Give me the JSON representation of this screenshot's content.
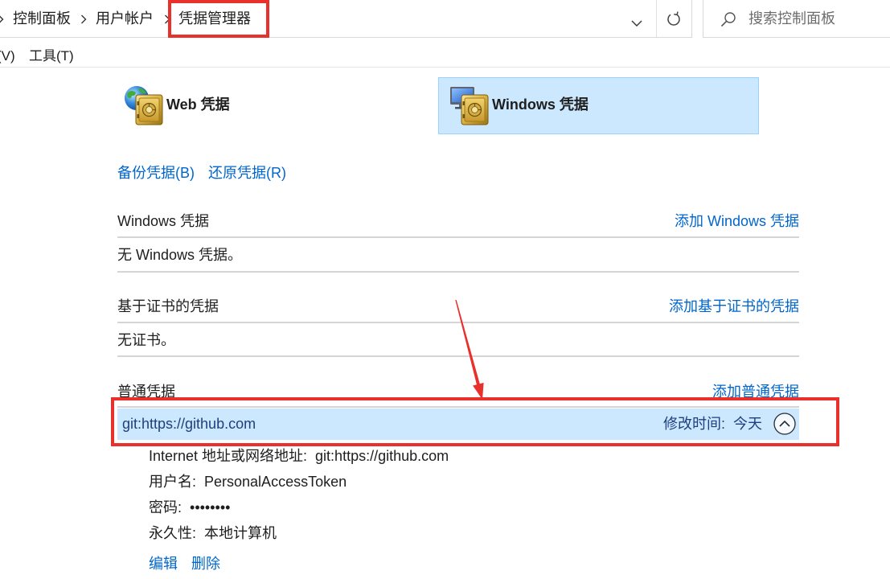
{
  "address_bar": {
    "breadcrumbs": [
      "控制面板",
      "用户帐户",
      "凭据管理器"
    ],
    "search_placeholder": "搜索控制面板"
  },
  "menu": {
    "items": [
      "(V)",
      "工具(T)"
    ]
  },
  "credential_types": [
    {
      "label": "Web 凭据",
      "icon": "globe-safe-icon",
      "selected": false
    },
    {
      "label": "Windows 凭据",
      "icon": "monitor-safe-icon",
      "selected": true
    }
  ],
  "actions": {
    "backup": "备份凭据(B)",
    "restore": "还原凭据(R)"
  },
  "sections": [
    {
      "title": "Windows 凭据",
      "add_label": "添加 Windows 凭据",
      "empty_text": "无 Windows 凭据。"
    },
    {
      "title": "基于证书的凭据",
      "add_label": "添加基于证书的凭据",
      "empty_text": "无证书。"
    },
    {
      "title": "普通凭据",
      "add_label": "添加普通凭据"
    }
  ],
  "generic_credential": {
    "name": "git:https://github.com",
    "modified_label": "修改时间:",
    "modified_value": "今天",
    "expanded": true,
    "details": [
      {
        "label": "Internet 地址或网络地址:",
        "value": "git:https://github.com"
      },
      {
        "label": "用户名:",
        "value": "PersonalAccessToken"
      },
      {
        "label": "密码:",
        "value": "••••••••"
      },
      {
        "label": "永久性:",
        "value": "本地计算机"
      }
    ],
    "edit_label": "编辑",
    "delete_label": "删除"
  },
  "icons": {
    "breadcrumb_separator": "chevron-right-icon",
    "recent_locations": "chevron-down-icon",
    "refresh": "refresh-icon",
    "search": "search-icon",
    "collapse": "chevron-up-circle-icon"
  },
  "colors": {
    "link": "#0066cc",
    "selection": "#cce8ff",
    "selection_border": "#99d1ff",
    "selected_text": "#1e3f7d",
    "annotation": "#e8312c"
  }
}
